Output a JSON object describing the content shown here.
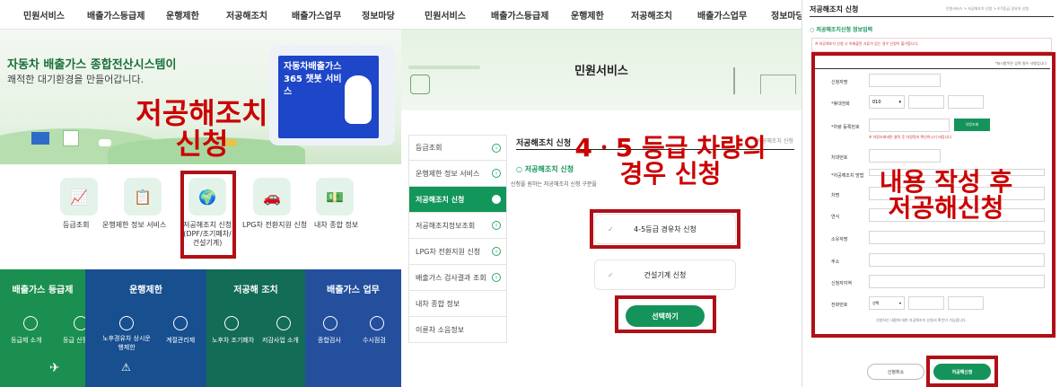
{
  "panel1": {
    "nav": [
      "민원서비스",
      "배출가스등급제",
      "운행제한",
      "저공해조치",
      "배출가스업무",
      "정보마당"
    ],
    "hero_title": "자동차 배출가스 종합전산시스템이",
    "hero_sub": "쾌적한 대기환경을 만들어갑니다.",
    "chatbot": "자동차배출가스365 챗봇 서비스",
    "annotation": [
      "저공해조치",
      "신청"
    ],
    "quick": [
      "등급조회",
      "운행제한 정보 서비스",
      "저공해조치 신청\n(DPF/조기폐차/\n건설기계)",
      "LPG차 전환지원 신청",
      "내차 종합 정보"
    ],
    "sections": [
      {
        "title": "배출가스 등급제",
        "items": [
          "등급제 소개",
          "등급 산정기준"
        ]
      },
      {
        "title": "운행제한",
        "items": [
          "노후경유차 상시운행제한",
          "계절관리제"
        ]
      },
      {
        "title": "저공해 조치",
        "items": [
          "노후차 조기폐차",
          "저감사업 소개"
        ]
      },
      {
        "title": "배출가스 업무",
        "items": [
          "종합검사",
          "수시점검"
        ]
      }
    ]
  },
  "panel2": {
    "nav": [
      "민원서비스",
      "배출가스등급제",
      "운행제한",
      "저공해조치",
      "배출가스업무",
      "정보마당"
    ],
    "hero_title": "민원서비스",
    "side": [
      "등급조회",
      "운행제한 정보 서비스",
      "저공해조치 신청",
      "저공해조치정보조회",
      "LPG차 전환지원 신청",
      "배출가스 검사결과 조회",
      "내차 종합 정보",
      "이륜차 소음정보"
    ],
    "page_title": "저공해조치 신청",
    "breadcrumb": "저공해조치 신청",
    "sub_title": "저공해조치 신청",
    "desc": "신청을 원하는 저공해조치 신청 구분을",
    "annotation": [
      "4ㆍ5 등급 차량의",
      "경우 신청"
    ],
    "opt1": "4-5등급 경유차 신청",
    "opt2": "건설기계 신청",
    "select_btn": "선택하기"
  },
  "panel3": {
    "title": "저공해조치 신청",
    "breadcrumb": "민원서비스 > 저공해조치 신청 > 4-5등급 경유차 신청",
    "section": "저공해조치신청 정보입력",
    "notice": "※ 저공해조치 신청 시 미제출된 서류가 있는 경우 신청이 불가합니다.",
    "required_note": "*표시항목은 입력 필수 사항입니다",
    "fields": [
      "신청자명",
      "*휴대전화",
      "*차량 등록번호",
      "차대번호",
      "*저공해조치 방법",
      "차명",
      "연식",
      "소유자명",
      "주소",
      "신청자지역",
      "전화번호"
    ],
    "phone_prefix": "010",
    "lookup_btn": "차량조회",
    "warn": "※ 차량조회버튼 클릭 후 차량정보 확인하시기 바랍니다.",
    "select_placeholder": "선택",
    "annotation": [
      "내용 작성 후",
      "저공해신청"
    ],
    "footer_note": "신청하신 내용에 대한 저공해조치 신청서 확인이 가능합니다.",
    "cancel_btn": "신청취소",
    "submit_btn": "저공해신청"
  }
}
